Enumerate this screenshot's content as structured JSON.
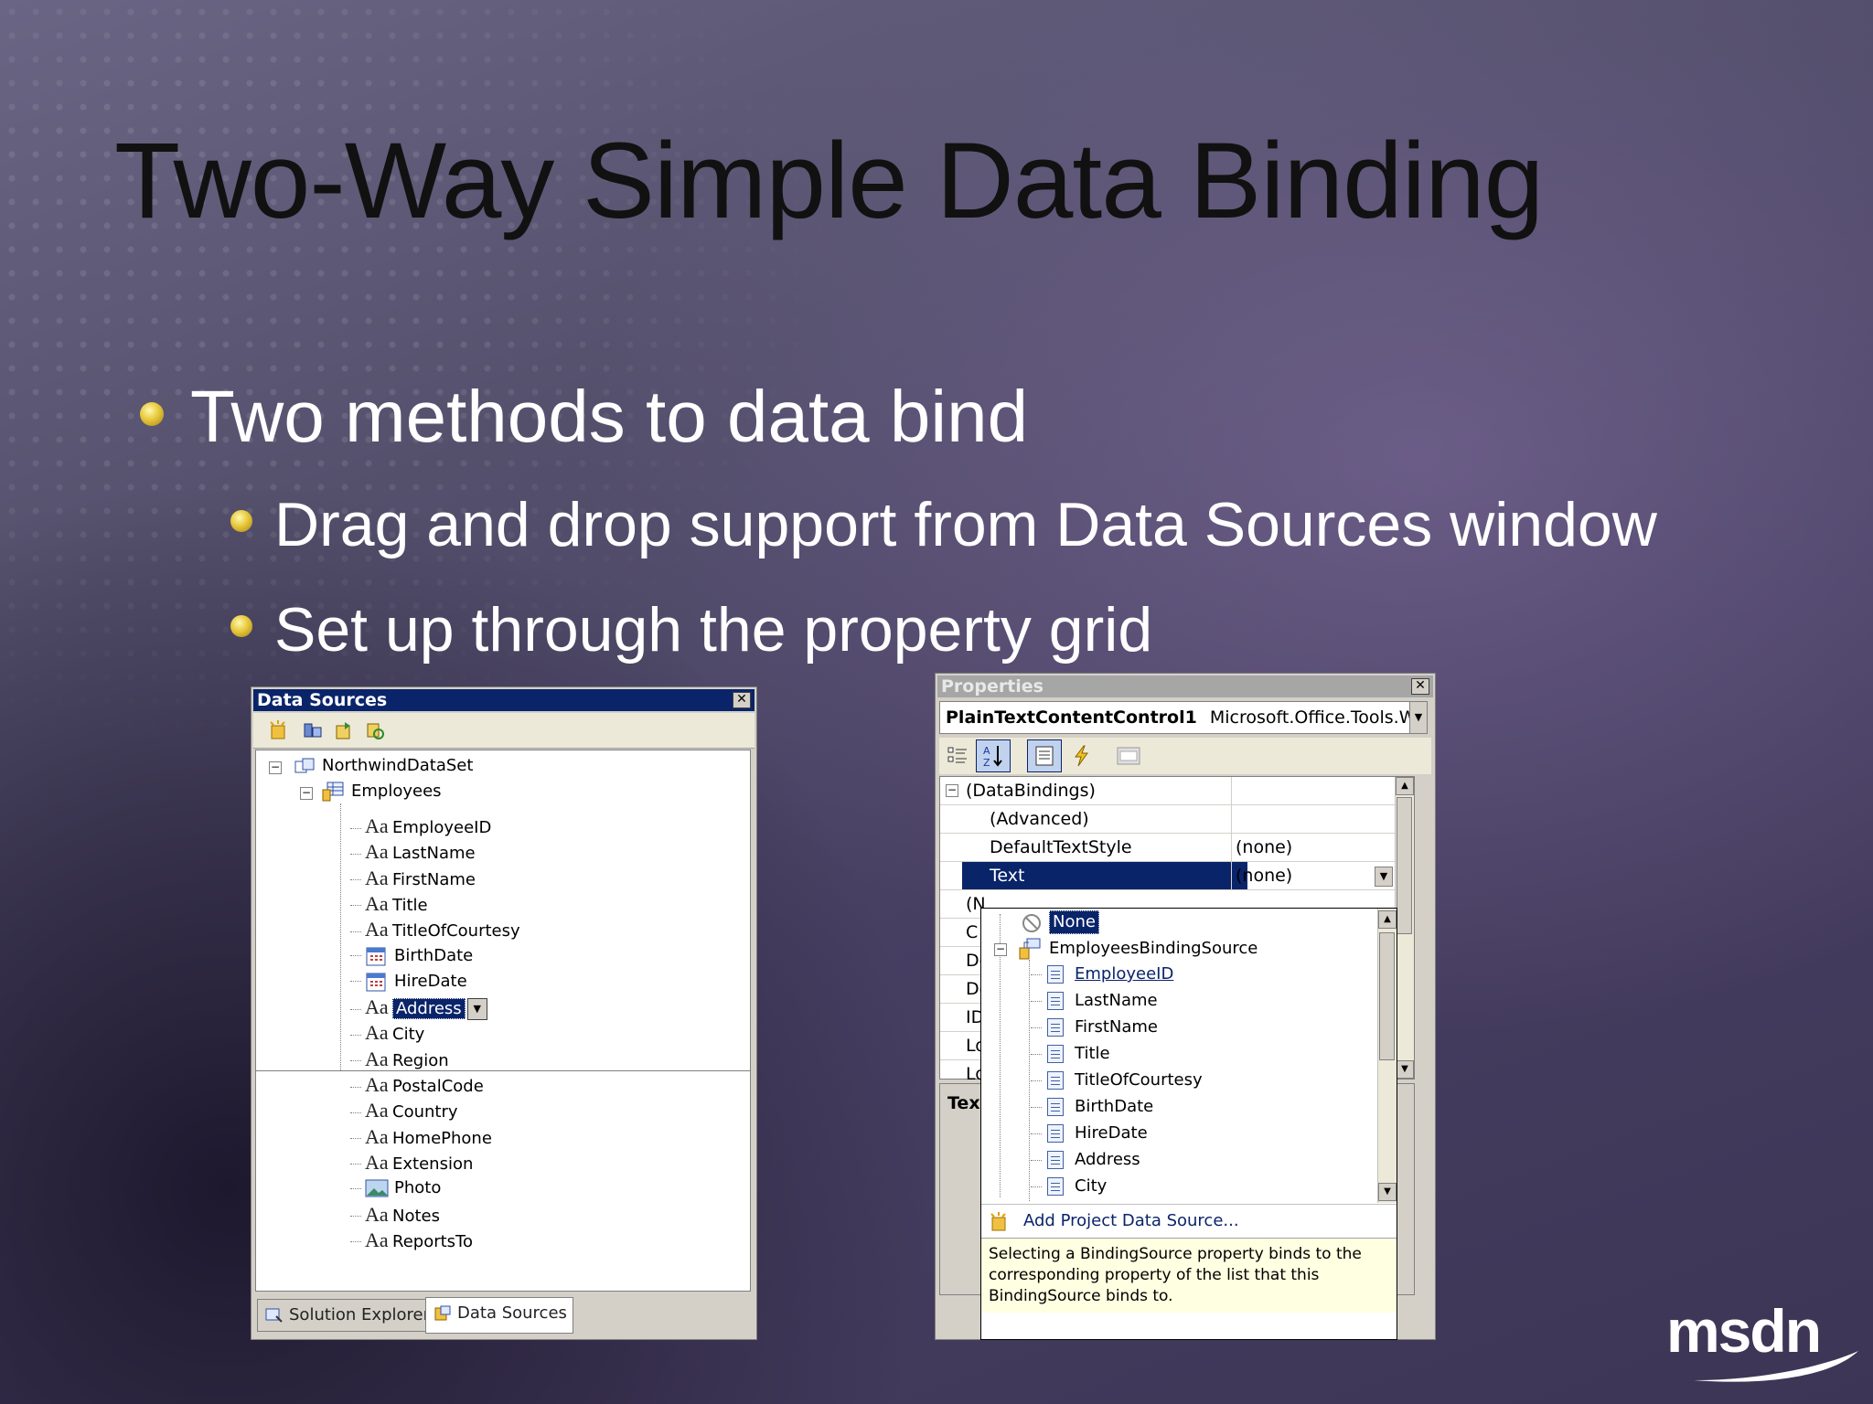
{
  "slide": {
    "title": "Two-Way Simple Data Binding",
    "bullets": [
      "Two methods to data bind",
      "Drag and drop support from Data Sources window",
      "Set up through the property grid"
    ]
  },
  "data_sources": {
    "title": "Data Sources",
    "close_glyph": "✕",
    "root": "NorthwindDataSet",
    "table": "Employees",
    "fields": [
      "EmployeeID",
      "LastName",
      "FirstName",
      "Title",
      "TitleOfCourtesy",
      "BirthDate",
      "HireDate",
      "Address",
      "City",
      "Region",
      "PostalCode",
      "Country",
      "HomePhone",
      "Extension",
      "Photo",
      "Notes",
      "ReportsTo"
    ],
    "selected_field": "Address",
    "tabs": [
      "Solution Explorer",
      "Data Sources"
    ],
    "active_tab": "Data Sources"
  },
  "properties": {
    "title": "Properties",
    "close_glyph": "✕",
    "object_name": "PlainTextContentControl1",
    "object_type": "Microsoft.Office.Tools.Wc",
    "rows": [
      {
        "key": "(DataBindings)",
        "value": ""
      },
      {
        "key": "(Advanced)",
        "value": ""
      },
      {
        "key": "DefaultTextStyle",
        "value": "(none)"
      },
      {
        "key": "Text",
        "value": "(none)"
      }
    ],
    "partial_rows": [
      "(N",
      "C",
      "De",
      "De",
      "ID",
      "Lo",
      "Lo"
    ],
    "desc_fragment": "Tex",
    "dropdown": {
      "none_label": "None",
      "binding_source": "EmployeesBindingSource",
      "fields": [
        "EmployeeID",
        "LastName",
        "FirstName",
        "Title",
        "TitleOfCourtesy",
        "BirthDate",
        "HireDate",
        "Address",
        "City"
      ],
      "add_label": "Add Project Data Source...",
      "help_text": "Selecting a BindingSource property binds to the corresponding property of the list that this BindingSource binds to."
    }
  },
  "logo": "msdn",
  "colors": {
    "titlebar_active": "#0a246a",
    "titlebar_inactive": "#a6a6a6",
    "bullet": "#e7c83a",
    "selection": "#0a246a",
    "help_bg": "#ffffe1"
  }
}
